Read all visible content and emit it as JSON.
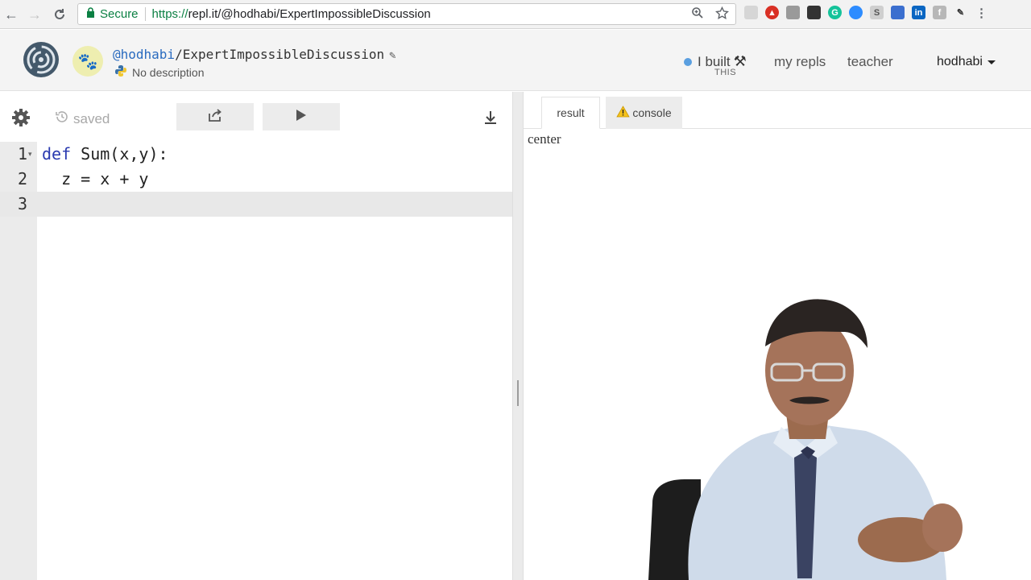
{
  "browser": {
    "secure_label": "Secure",
    "url_scheme": "https://",
    "url_rest": "repl.it/@hodhabi/ExpertImpossibleDiscussion"
  },
  "header": {
    "owner": "@hodhabi",
    "slash": "/",
    "repl_name": "ExpertImpossibleDiscussion",
    "description": "No description",
    "ibuilt_label": "I built",
    "ibuilt_sub": "THIS",
    "nav": [
      "my repls",
      "teacher"
    ],
    "username": "hodhabi"
  },
  "editor": {
    "saved_label": "saved",
    "lines": [
      {
        "num": "1",
        "keyword": "def",
        "rest": " Sum(x,y):"
      },
      {
        "num": "2",
        "keyword": "",
        "rest": "  z = x + y"
      },
      {
        "num": "3",
        "keyword": "",
        "rest": ""
      }
    ]
  },
  "output": {
    "tabs": [
      "result",
      "console"
    ],
    "result_text": "center"
  },
  "colors": {
    "secure_green": "#0b8043",
    "owner_blue": "#2a6bbf",
    "keyword_blue": "#2a3ab0"
  }
}
